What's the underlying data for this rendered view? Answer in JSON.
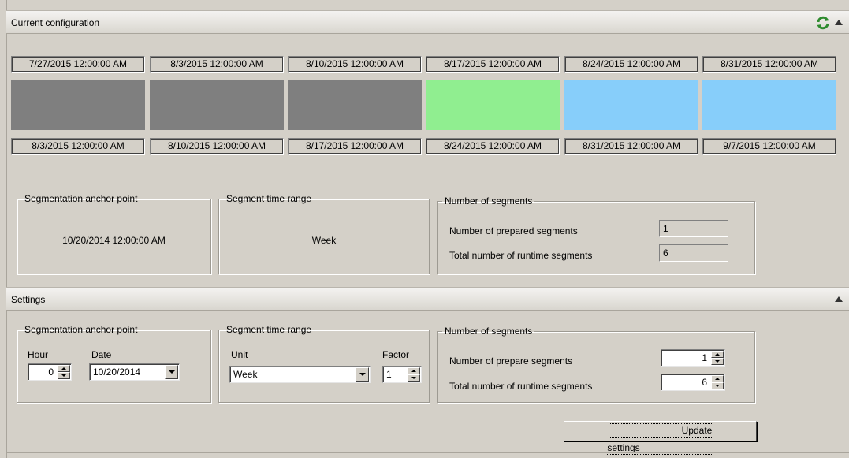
{
  "current": {
    "title": "Current configuration",
    "start_dates": [
      "7/27/2015 12:00:00 AM",
      "8/3/2015 12:00:00 AM",
      "8/10/2015 12:00:00 AM",
      "8/17/2015 12:00:00 AM",
      "8/24/2015 12:00:00 AM",
      "8/31/2015 12:00:00 AM"
    ],
    "end_dates": [
      "8/3/2015 12:00:00 AM",
      "8/10/2015 12:00:00 AM",
      "8/17/2015 12:00:00 AM",
      "8/24/2015 12:00:00 AM",
      "8/31/2015 12:00:00 AM",
      "9/7/2015 12:00:00 AM"
    ],
    "segment_colors": [
      "#7f7f7f",
      "#7f7f7f",
      "#7f7f7f",
      "#90ee90",
      "#87cefa",
      "#87cefa"
    ],
    "anchor": {
      "legend": "Segmentation anchor point",
      "value": "10/20/2014 12:00:00 AM"
    },
    "range": {
      "legend": "Segment time range",
      "value": "Week"
    },
    "segments": {
      "legend": "Number of segments",
      "prepared_label": "Number of prepared segments",
      "prepared_value": "1",
      "runtime_label": "Total number of runtime segments",
      "runtime_value": "6"
    }
  },
  "settings": {
    "title": "Settings",
    "anchor": {
      "legend": "Segmentation anchor point",
      "hour_label": "Hour",
      "hour_value": "0",
      "date_label": "Date",
      "date_value": "10/20/2014"
    },
    "range": {
      "legend": "Segment time range",
      "unit_label": "Unit",
      "unit_value": "Week",
      "factor_label": "Factor",
      "factor_value": "1"
    },
    "segments": {
      "legend": "Number of segments",
      "prepare_label": "Number of prepare segments",
      "prepare_value": "1",
      "runtime_label": "Total number of runtime segments",
      "runtime_value": "6"
    },
    "update_label": "Update settings"
  },
  "icons": {
    "refresh": "refresh-icon",
    "collapse": "collapse-up-icon"
  }
}
